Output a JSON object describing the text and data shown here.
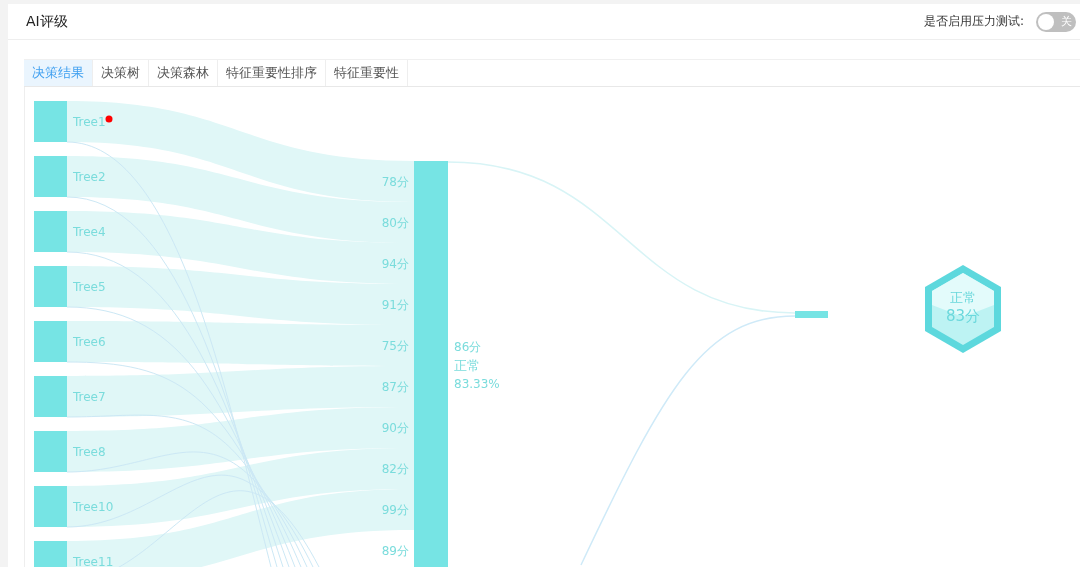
{
  "header": {
    "title": "AI评级",
    "stress_test": {
      "label": "是否启用压力测试:",
      "on": false,
      "state_text": "关"
    }
  },
  "tabs": [
    {
      "label": "决策结果",
      "selected": true
    },
    {
      "label": "决策树",
      "selected": false
    },
    {
      "label": "决策森林",
      "selected": false
    },
    {
      "label": "特征重要性排序",
      "selected": false
    },
    {
      "label": "特征重要性",
      "selected": false
    }
  ],
  "sankey": {
    "trees": [
      {
        "name": "Tree1",
        "alert": true
      },
      {
        "name": "Tree2",
        "alert": false
      },
      {
        "name": "Tree4",
        "alert": false
      },
      {
        "name": "Tree5",
        "alert": false
      },
      {
        "name": "Tree6",
        "alert": false
      },
      {
        "name": "Tree7",
        "alert": false
      },
      {
        "name": "Tree8",
        "alert": false
      },
      {
        "name": "Tree10",
        "alert": false
      },
      {
        "name": "Tree11",
        "alert": false
      }
    ],
    "scores": [
      "78分",
      "80分",
      "94分",
      "91分",
      "75分",
      "87分",
      "90分",
      "82分",
      "99分",
      "89分"
    ],
    "aggregate": {
      "score": "86分",
      "status": "正常",
      "percent": "83.33%"
    },
    "result": {
      "status": "正常",
      "score": "83分"
    }
  }
}
